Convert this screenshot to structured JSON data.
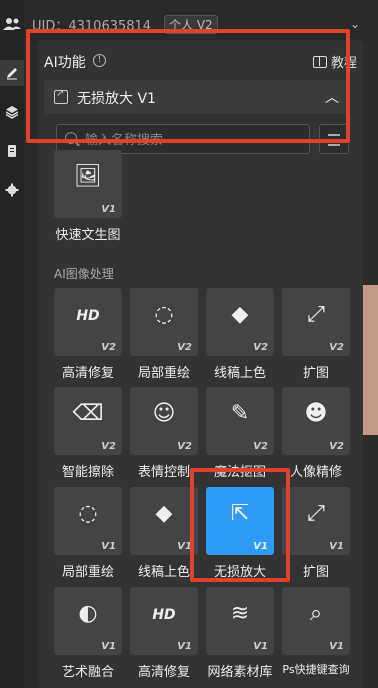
{
  "top": {
    "uid": "UID：4310635814",
    "badge": "个人 V2"
  },
  "panel": {
    "title": "AI功能",
    "info_icon": "info-icon",
    "tutorial": "教程",
    "dropdown_label": "无损放大 V1",
    "search_placeholder": "输入名称搜索",
    "section_label": "AI图像处理"
  },
  "tools": [
    {
      "name": "quick-text-to-image",
      "label": "快速文生图",
      "ver": "V1",
      "icon": "image-text-icon"
    },
    {
      "name": "hd-repair",
      "label": "高清修复",
      "ver": "V2",
      "icon": "hd-icon"
    },
    {
      "name": "local-redraw",
      "label": "局部重绘",
      "ver": "V2",
      "icon": "brush-circle-icon"
    },
    {
      "name": "lineart-color",
      "label": "线稿上色",
      "ver": "V2",
      "icon": "paint-bucket-icon"
    },
    {
      "name": "expand",
      "label": "扩图",
      "ver": "V2",
      "icon": "expand-icon"
    },
    {
      "name": "smart-erase",
      "label": "智能擦除",
      "ver": "V2",
      "icon": "eraser-icon"
    },
    {
      "name": "expression-control",
      "label": "表情控制",
      "ver": "V2",
      "icon": "smile-icon"
    },
    {
      "name": "magic-cutout",
      "label": "魔法抠图",
      "ver": "V2",
      "icon": "magic-wand-icon"
    },
    {
      "name": "portrait-refine",
      "label": "人像精修",
      "ver": "V2",
      "icon": "head-icon"
    },
    {
      "name": "local-redraw-v1",
      "label": "局部重绘",
      "ver": "V1",
      "icon": "brush-circle-icon"
    },
    {
      "name": "lineart-color-v1",
      "label": "线稿上色",
      "ver": "V1",
      "icon": "paint-bucket-icon"
    },
    {
      "name": "lossless-upscale",
      "label": "无损放大",
      "ver": "V1",
      "icon": "upscale-icon"
    },
    {
      "name": "expand-v1",
      "label": "扩图",
      "ver": "V1",
      "icon": "expand-icon"
    },
    {
      "name": "art-fusion",
      "label": "艺术融合",
      "ver": "V1",
      "icon": "fusion-icon"
    },
    {
      "name": "hd-repair-v1",
      "label": "高清修复",
      "ver": "V1",
      "icon": "hd-icon"
    },
    {
      "name": "web-material-library",
      "label": "网络素材库",
      "ver": "V1",
      "icon": "layers-icon"
    },
    {
      "name": "ps-shortcut-lookup",
      "label": "Ps快捷键查询",
      "ver": "V1",
      "icon": "shortcut-search-icon"
    }
  ],
  "selected_tool": "lossless-upscale",
  "colors": {
    "accent": "#2f9bf7",
    "highlight": "#e0432c",
    "panel": "#333333",
    "tile": "#444444"
  }
}
